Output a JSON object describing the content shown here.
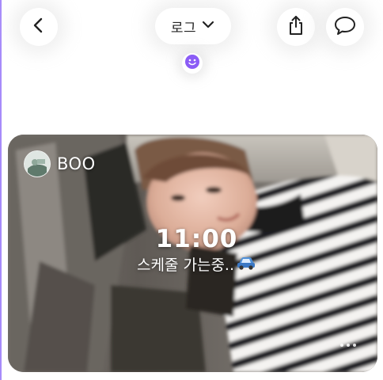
{
  "header": {
    "title": "로그",
    "back_icon": "chevron-left-icon",
    "title_dropdown_icon": "chevron-down-icon",
    "share_icon": "share-icon",
    "chat_icon": "chat-bubble-icon",
    "status_icon": "smiley-icon",
    "status_icon_color": "#8b5cf6"
  },
  "post": {
    "user_name": "BOO",
    "time": "11:00",
    "caption": "스케줄 가는중..",
    "caption_emoji_icon": "car-icon",
    "more_icon": "more-dots-icon"
  },
  "colors": {
    "accent": "#a78bfa",
    "text_primary": "#222222",
    "overlay_text": "#ffffff"
  }
}
